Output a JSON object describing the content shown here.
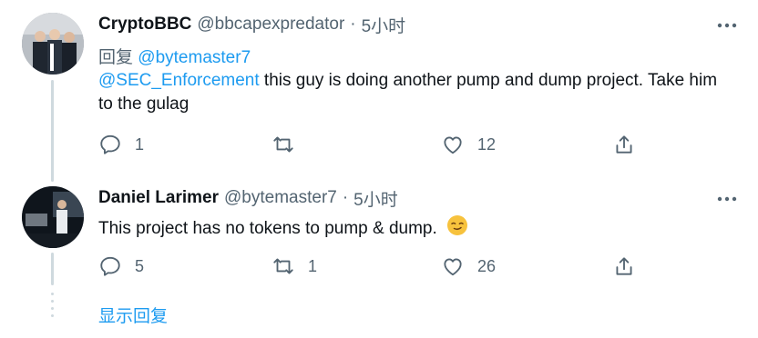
{
  "tweets": [
    {
      "name": "CryptoBBC",
      "handle": "@bbcapexpredator",
      "separator": "·",
      "time": "5小时",
      "replying_label": "回复",
      "replying_to": "@bytemaster7",
      "mention": "@SEC_Enforcement",
      "text": " this guy is doing another pump and dump project. Take him to the gulag",
      "replies": "1",
      "retweets": "",
      "likes": "12"
    },
    {
      "name": "Daniel Larimer",
      "handle": "@bytemaster7",
      "separator": "·",
      "time": "5小时",
      "text": "This project has no tokens to pump & dump.",
      "emoji": "smirking-face",
      "replies": "5",
      "retweets": "1",
      "likes": "26"
    }
  ],
  "show_replies": "显示回复",
  "colors": {
    "accent": "#1d9bf0",
    "secondary_text": "#536471",
    "thread_line": "#cfd9de",
    "emoji_yellow": "#f7c23d"
  }
}
